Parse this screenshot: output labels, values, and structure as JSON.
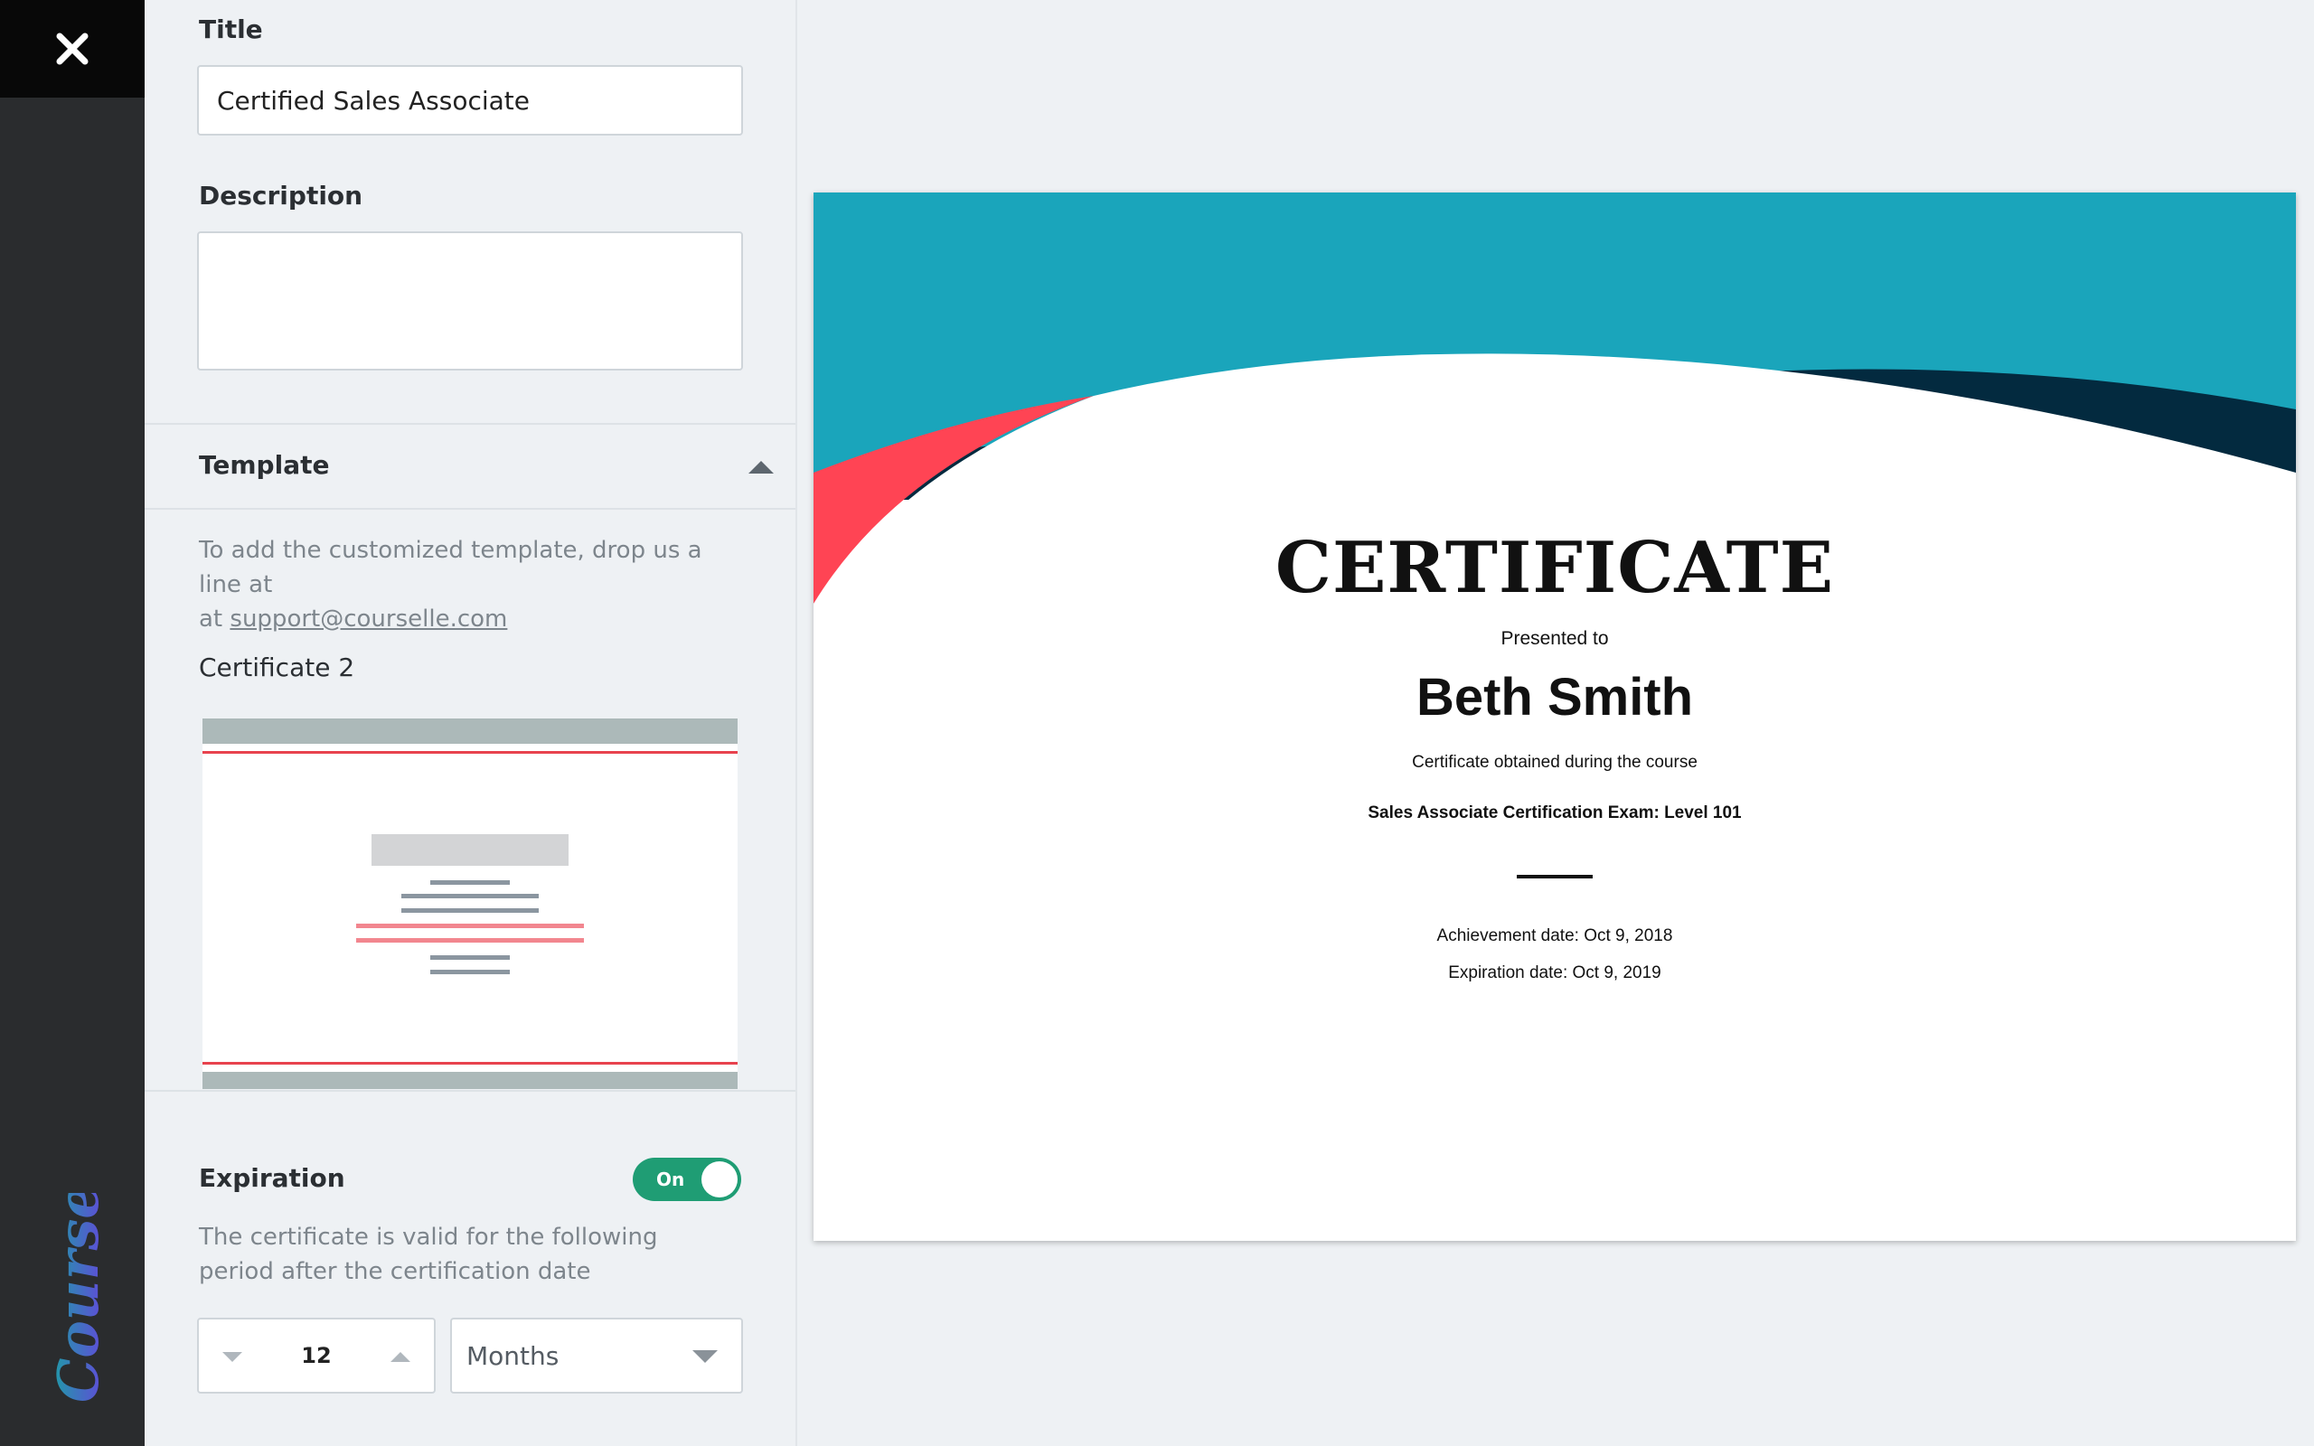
{
  "close_icon": "close-icon",
  "brand": {
    "name": "Courselle",
    "gradient": [
      "#6a3fe0",
      "#16a6a0"
    ]
  },
  "form": {
    "title_label": "Title",
    "title_value": "Certified Sales Associate",
    "description_label": "Description",
    "description_value": ""
  },
  "template": {
    "heading": "Template",
    "help_text": "To add the customized template, drop us a line at",
    "help_link": "support@courselle.com",
    "help_text_2": "at",
    "selected_name": "Certificate 2"
  },
  "expiration": {
    "heading": "Expiration",
    "toggle_label": "On",
    "enabled": true,
    "help_line_1": "The certificate is valid for the following",
    "help_line_2": "period after the certification date",
    "period_value": "12",
    "period_unit": "Months"
  },
  "certificate": {
    "title": "CERTIFICATE",
    "presented_to": "Presented to",
    "recipient": "Beth Smith",
    "obtained_text": "Certificate obtained during the course",
    "course": "Sales Associate Certification Exam: Level 101",
    "achievement": "Achievement date: Oct 9, 2018",
    "expiration": "Expiration date: Oct 9, 2019",
    "colors": {
      "teal": "#1aa5bb",
      "navy": "#032a3f",
      "coral": "#ff4454"
    }
  },
  "colors": {
    "toggle_on": "#1f9d74",
    "rail": "#2a2c2e",
    "close_bg": "#080808"
  }
}
